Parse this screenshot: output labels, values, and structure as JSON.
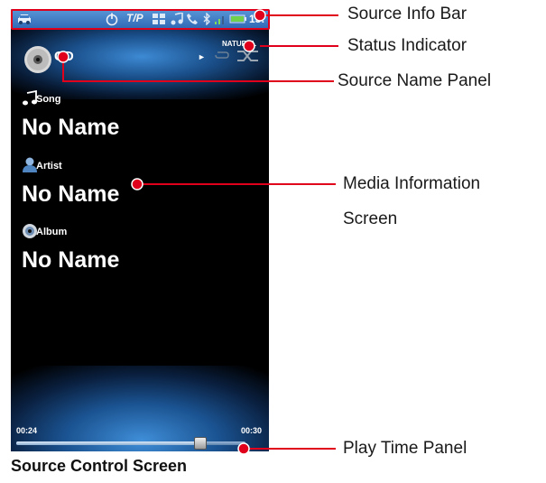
{
  "status_bar": {
    "tp_label": "T/P",
    "time": "15:"
  },
  "source": {
    "label": "CD",
    "sound_mode": "NATURAL"
  },
  "media": {
    "song_label": "Song",
    "song_value": "No Name",
    "artist_label": "Artist",
    "artist_value": "No Name",
    "album_label": "Album",
    "album_value": "No Name"
  },
  "playback": {
    "elapsed": "00:24",
    "total": "00:30",
    "progress": 0.8
  },
  "callouts": {
    "source_info_bar": "Source Info Bar",
    "status_indicator": "Status Indicator",
    "source_name_panel": "Source Name Panel",
    "media_information_line1": "Media Information",
    "media_information_line2": "Screen",
    "play_time_panel": "Play Time Panel"
  },
  "caption": "Source Control Screen",
  "colors": {
    "callout_red": "#e0001b",
    "status_bar_blue": "#3f7cc4"
  }
}
